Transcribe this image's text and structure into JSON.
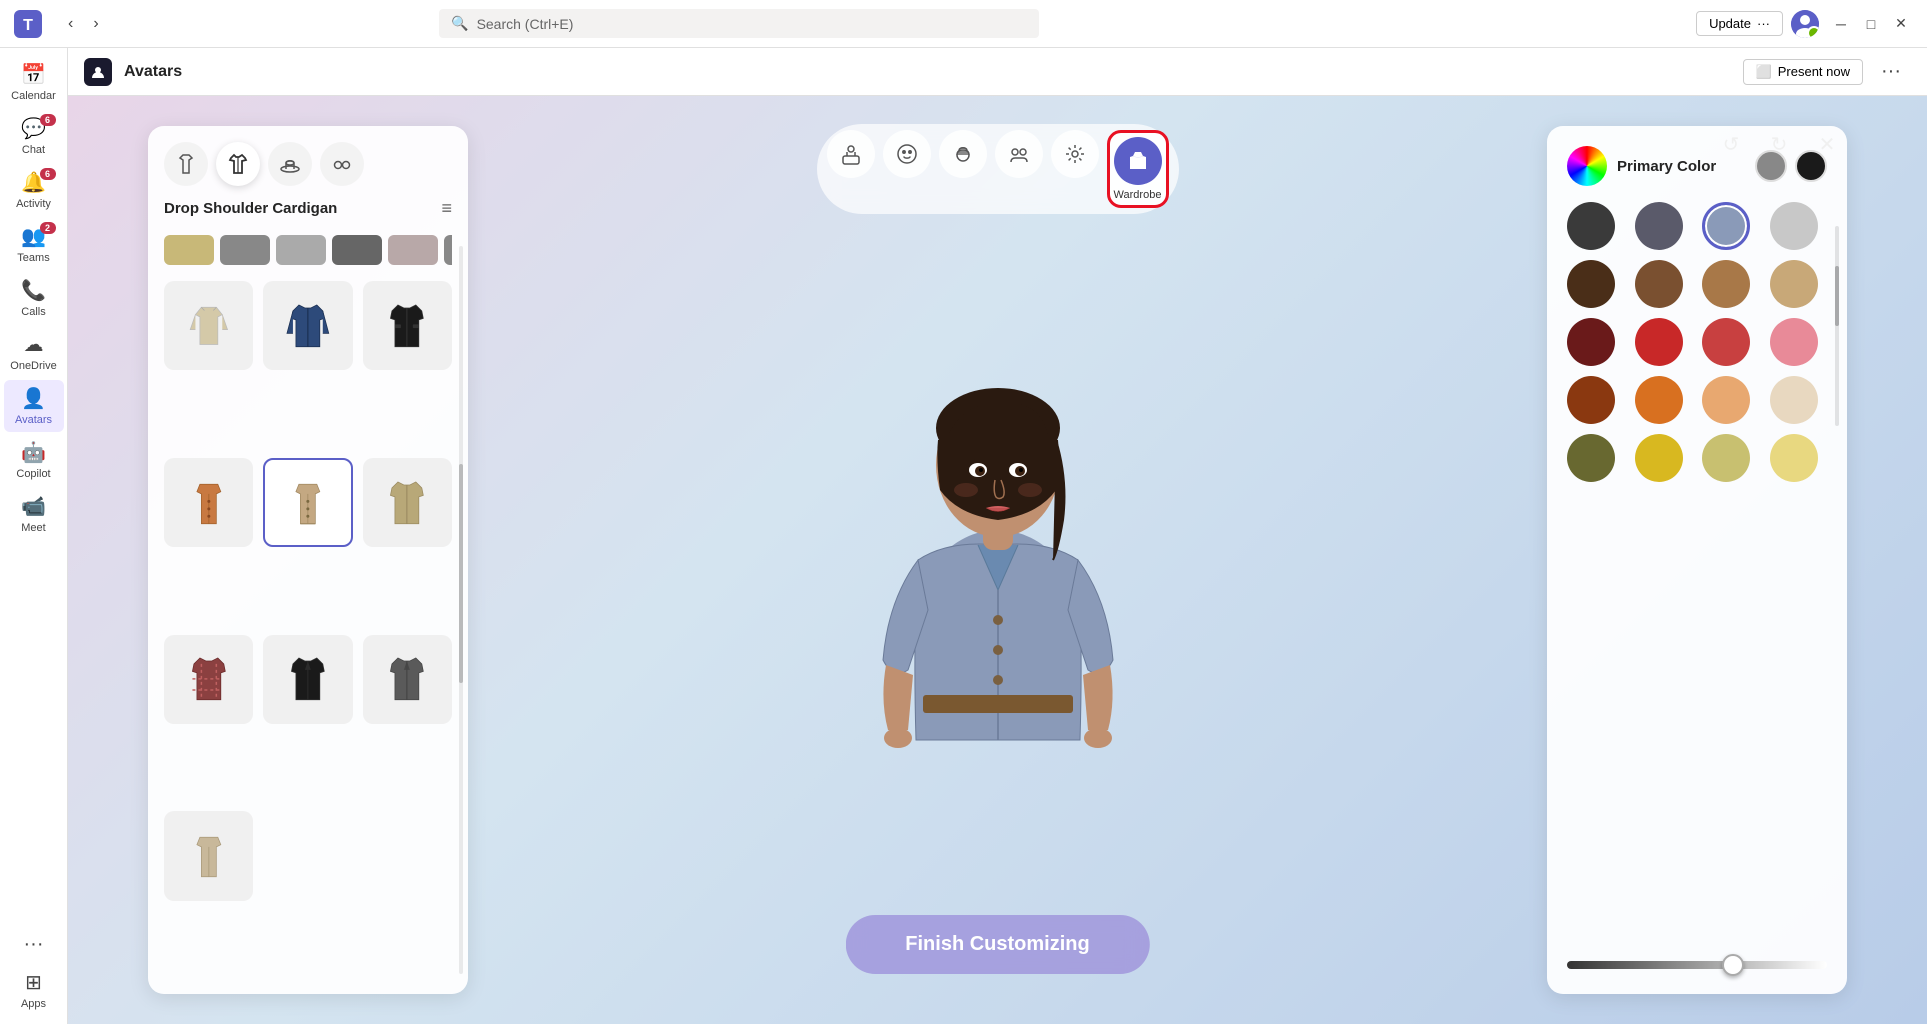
{
  "titlebar": {
    "app_name": "Microsoft Teams",
    "search_placeholder": "Search (Ctrl+E)",
    "update_label": "Update",
    "more_label": "···",
    "minimize_label": "─",
    "maximize_label": "□",
    "close_label": "✕"
  },
  "sidebar": {
    "items": [
      {
        "id": "calendar",
        "label": "Calendar",
        "icon": "📅",
        "badge": null,
        "active": false
      },
      {
        "id": "chat",
        "label": "Chat",
        "icon": "💬",
        "badge": "6",
        "active": false
      },
      {
        "id": "activity",
        "label": "Activity",
        "icon": "🔔",
        "badge": "6",
        "active": false
      },
      {
        "id": "teams",
        "label": "Teams",
        "icon": "👥",
        "badge": "2",
        "active": false
      },
      {
        "id": "calls",
        "label": "Calls",
        "icon": "📞",
        "badge": null,
        "active": false
      },
      {
        "id": "onedrive",
        "label": "OneDrive",
        "icon": "☁",
        "badge": null,
        "active": false
      },
      {
        "id": "avatars",
        "label": "Avatars",
        "icon": "👤",
        "badge": null,
        "active": true
      },
      {
        "id": "copilot",
        "label": "Copilot",
        "icon": "🤖",
        "badge": null,
        "active": false
      },
      {
        "id": "meet",
        "label": "Meet",
        "icon": "📹",
        "badge": null,
        "active": false
      },
      {
        "id": "more",
        "label": "···",
        "icon": "···",
        "badge": null,
        "active": false
      },
      {
        "id": "apps",
        "label": "Apps",
        "icon": "⊞",
        "badge": null,
        "active": false
      }
    ]
  },
  "page_header": {
    "icon": "🧩",
    "title": "Avatars",
    "present_now_label": "Present now",
    "more_label": "···"
  },
  "toolbar": {
    "buttons": [
      {
        "id": "pose",
        "icon": "🪑",
        "label": null,
        "active": false
      },
      {
        "id": "face",
        "icon": "😊",
        "label": null,
        "active": false
      },
      {
        "id": "hair",
        "icon": "💆",
        "label": null,
        "active": false
      },
      {
        "id": "body",
        "icon": "👥",
        "label": null,
        "active": false
      },
      {
        "id": "accessories",
        "icon": "🎭",
        "label": null,
        "active": false
      },
      {
        "id": "wardrobe",
        "icon": "👕",
        "label": "Wardrobe",
        "active": true
      }
    ],
    "undo_label": "↺",
    "redo_label": "↻",
    "close_label": "✕"
  },
  "wardrobe": {
    "title": "Drop Shoulder Cardigan",
    "tabs": [
      {
        "id": "tops",
        "icon": "👕",
        "active": false
      },
      {
        "id": "bottoms",
        "icon": "🧥",
        "active": true
      },
      {
        "id": "hats",
        "icon": "🎩",
        "active": false
      },
      {
        "id": "glasses",
        "icon": "🕶",
        "active": false
      }
    ],
    "items": [
      {
        "id": "hoodie-cream",
        "selected": false,
        "color": "#d4c9a8"
      },
      {
        "id": "jacket-blue",
        "selected": false,
        "color": "#2d4a7a"
      },
      {
        "id": "jacket-black-military",
        "selected": false,
        "color": "#1a1a1a"
      },
      {
        "id": "cardigan-orange",
        "selected": false,
        "color": "#c87941"
      },
      {
        "id": "cardigan-tan",
        "selected": true,
        "color": "#c4a882"
      },
      {
        "id": "jacket-khaki",
        "selected": false,
        "color": "#b8a878"
      },
      {
        "id": "jacket-plaid",
        "selected": false,
        "color": "#8b4040"
      },
      {
        "id": "blazer-black",
        "selected": false,
        "color": "#1a1a1a"
      },
      {
        "id": "blazer-gray",
        "selected": false,
        "color": "#5a5a5a"
      },
      {
        "id": "jacket-beige",
        "selected": false,
        "color": "#c8b89a"
      }
    ]
  },
  "color_panel": {
    "title": "Primary Color",
    "swatches": [
      {
        "id": "dark-gray",
        "color": "#3a3a3a",
        "selected": false
      },
      {
        "id": "medium-gray",
        "color": "#5a5a6a",
        "selected": false
      },
      {
        "id": "light-blue-gray",
        "color": "#8a9ab8",
        "selected": true
      },
      {
        "id": "light-gray",
        "color": "#c8c8c8",
        "selected": false
      },
      {
        "id": "dark-brown",
        "color": "#4a2e18",
        "selected": false
      },
      {
        "id": "medium-brown",
        "color": "#7a5030",
        "selected": false
      },
      {
        "id": "tan-brown",
        "color": "#a87848",
        "selected": false
      },
      {
        "id": "light-tan",
        "color": "#c8a878",
        "selected": false
      },
      {
        "id": "dark-red",
        "color": "#6a1a1a",
        "selected": false
      },
      {
        "id": "red",
        "color": "#c82828",
        "selected": false
      },
      {
        "id": "medium-red",
        "color": "#c83838",
        "selected": false
      },
      {
        "id": "pink",
        "color": "#e88a98",
        "selected": false
      },
      {
        "id": "orange-brown",
        "color": "#8a3810",
        "selected": false
      },
      {
        "id": "orange",
        "color": "#d87020",
        "selected": false
      },
      {
        "id": "peach",
        "color": "#e8a870",
        "selected": false
      },
      {
        "id": "cream",
        "color": "#e8d8c0",
        "selected": false
      },
      {
        "id": "olive",
        "color": "#686830",
        "selected": false
      },
      {
        "id": "yellow",
        "color": "#d8b820",
        "selected": false
      },
      {
        "id": "light-olive",
        "color": "#c8c070",
        "selected": false
      },
      {
        "id": "light-yellow",
        "color": "#e8d880",
        "selected": false
      }
    ],
    "preview_colors": [
      "#888",
      "#1a1a1a"
    ],
    "brightness_value": 65
  },
  "finish_btn_label": "Finish Customizing"
}
